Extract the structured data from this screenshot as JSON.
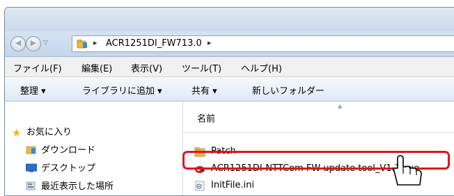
{
  "address": {
    "path_folder": "ACR1251DI_FW713.0",
    "separator": "▸"
  },
  "menu": [
    {
      "label": "ファイル(F)"
    },
    {
      "label": "編集(E)"
    },
    {
      "label": "表示(V)"
    },
    {
      "label": "ツール(T)"
    },
    {
      "label": "ヘルプ(H)"
    }
  ],
  "toolbar": {
    "organize": "整理 ▾",
    "add_to_library": "ライブラリに追加 ▾",
    "share": "共有 ▾",
    "new_folder": "新しいフォルダー"
  },
  "sidebar": {
    "favorites": "お気に入り",
    "items": [
      {
        "label": "ダウンロード",
        "icon": "download-folder-icon"
      },
      {
        "label": "デスクトップ",
        "icon": "desktop-icon"
      },
      {
        "label": "最近表示した場所",
        "icon": "recent-places-icon"
      }
    ]
  },
  "content": {
    "column_name": "名前",
    "files": [
      {
        "name": "Patch",
        "icon": "folder-icon"
      },
      {
        "name": "ACR1251DI-NTTCom FW update tool_V1.1.exe",
        "icon": "exe-icon"
      },
      {
        "name": "InitFile.ini",
        "icon": "ini-file-icon"
      }
    ]
  },
  "colors": {
    "highlight": "#e0131c",
    "folder": "#e8b84a"
  }
}
